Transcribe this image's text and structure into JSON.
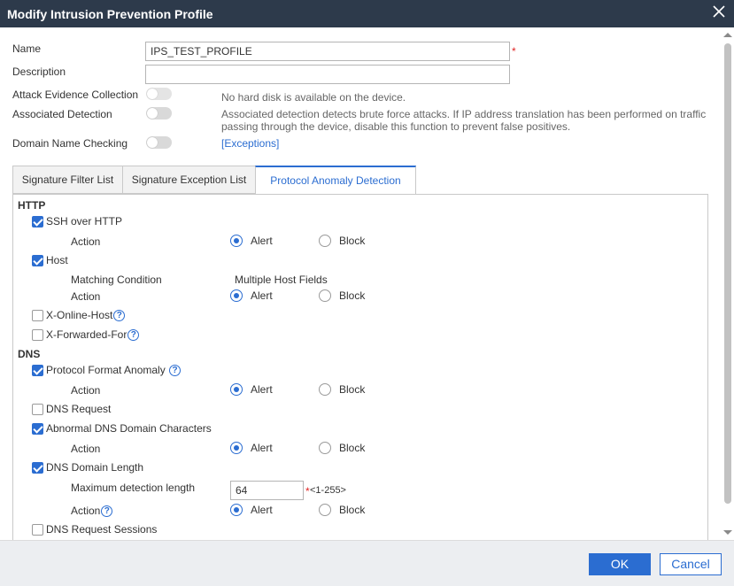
{
  "dialog": {
    "title": "Modify Intrusion Prevention Profile"
  },
  "form": {
    "name_label": "Name",
    "name_value": "IPS_TEST_PROFILE",
    "required_mark": "*",
    "description_label": "Description",
    "description_value": "",
    "attack_evidence_label": "Attack Evidence Collection",
    "attack_evidence_hint": "No hard disk is available on the device.",
    "associated_detection_label": "Associated Detection",
    "associated_detection_hint_1": "Associated detection detects brute force attacks. If IP address translation has been performed on traffic",
    "associated_detection_hint_2": "passing through the device, disable this function to prevent false positives.",
    "domain_name_checking_label": "Domain Name Checking",
    "exceptions_link": "[Exceptions]"
  },
  "tabs": [
    {
      "label": "Signature Filter List",
      "active": false
    },
    {
      "label": "Signature Exception List",
      "active": false
    },
    {
      "label": "Protocol Anomaly Detection",
      "active": true
    }
  ],
  "panel": {
    "http_heading": "HTTP",
    "ssh_over_http": "SSH over HTTP",
    "action": "Action",
    "alert": "Alert",
    "block": "Block",
    "host": "Host",
    "matching_condition": "Matching Condition",
    "matching_condition_value": "Multiple Host Fields",
    "x_online_host": "X-Online-Host",
    "x_forwarded_for": "X-Forwarded-For",
    "dns_heading": "DNS",
    "protocol_format_anomaly": "Protocol Format Anomaly",
    "dns_request": "DNS Request",
    "abnormal_dns_domain_characters": "Abnormal DNS Domain Characters",
    "dns_domain_length": "DNS Domain Length",
    "max_detection_length_label": "Maximum detection length",
    "max_detection_length_value": "64",
    "max_detection_length_range": "<1-255>",
    "dns_request_sessions": "DNS Request Sessions",
    "help_glyph": "?"
  },
  "footer": {
    "ok_label": "OK",
    "cancel_label": "Cancel"
  },
  "colors": {
    "titlebar": "#2d3a4b",
    "accent": "#2b6dd1",
    "required": "#e02424"
  }
}
